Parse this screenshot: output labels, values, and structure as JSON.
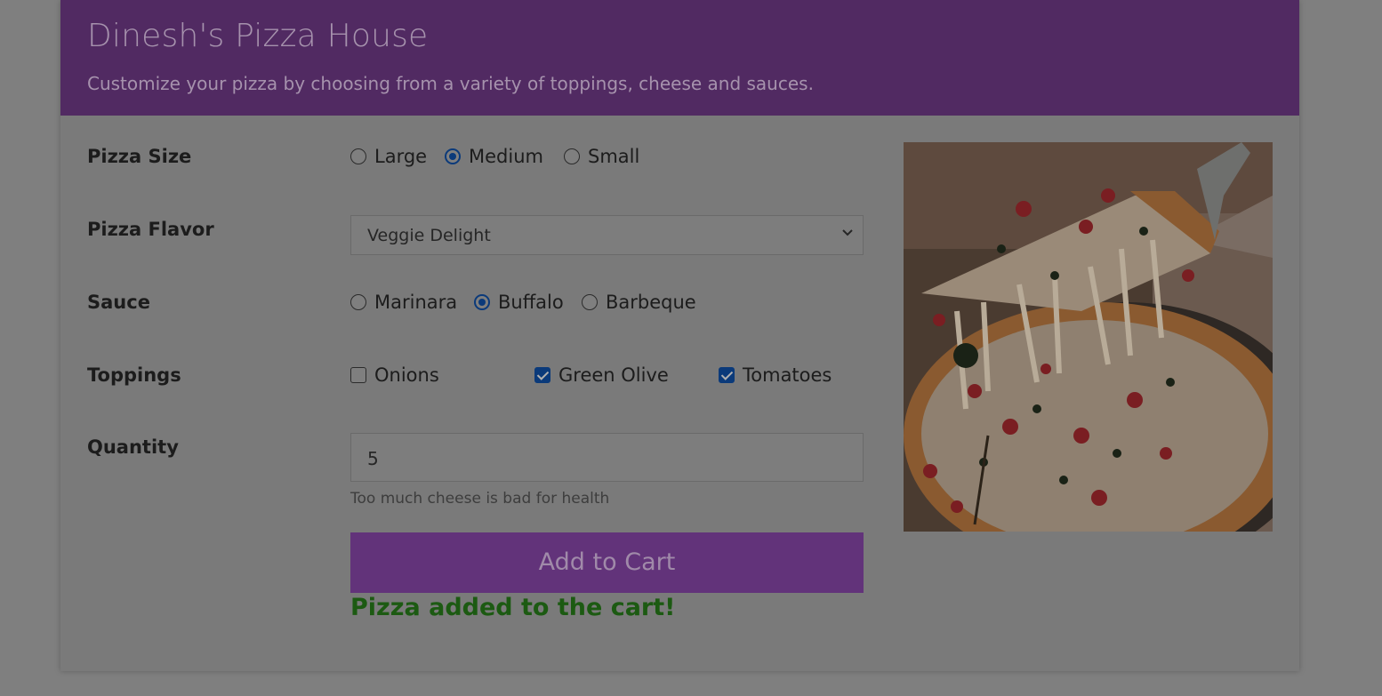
{
  "header": {
    "title": "Dinesh's Pizza House",
    "subtitle": "Customize your pizza by choosing from a variety of toppings, cheese and sauces."
  },
  "size": {
    "label": "Pizza Size",
    "options": [
      "Large",
      "Medium",
      "Small"
    ],
    "selected": "Medium"
  },
  "flavor": {
    "label": "Pizza Flavor",
    "selected": "Veggie Delight"
  },
  "sauce": {
    "label": "Sauce",
    "options": [
      "Marinara",
      "Buffalo",
      "Barbeque"
    ],
    "selected": "Buffalo"
  },
  "toppings": {
    "label": "Toppings",
    "options": [
      "Onions",
      "Green Olive",
      "Tomatoes"
    ],
    "checked": [
      "Green Olive",
      "Tomatoes"
    ]
  },
  "quantity": {
    "label": "Quantity",
    "value": "5",
    "hint": "Too much cheese is bad for health"
  },
  "cart": {
    "button_label": "Add to Cart",
    "success_message": "Pizza added to the cart!"
  },
  "colors": {
    "header_bg": "#512a62",
    "button_bg": "#62337a",
    "success_text": "#1c5a12"
  }
}
